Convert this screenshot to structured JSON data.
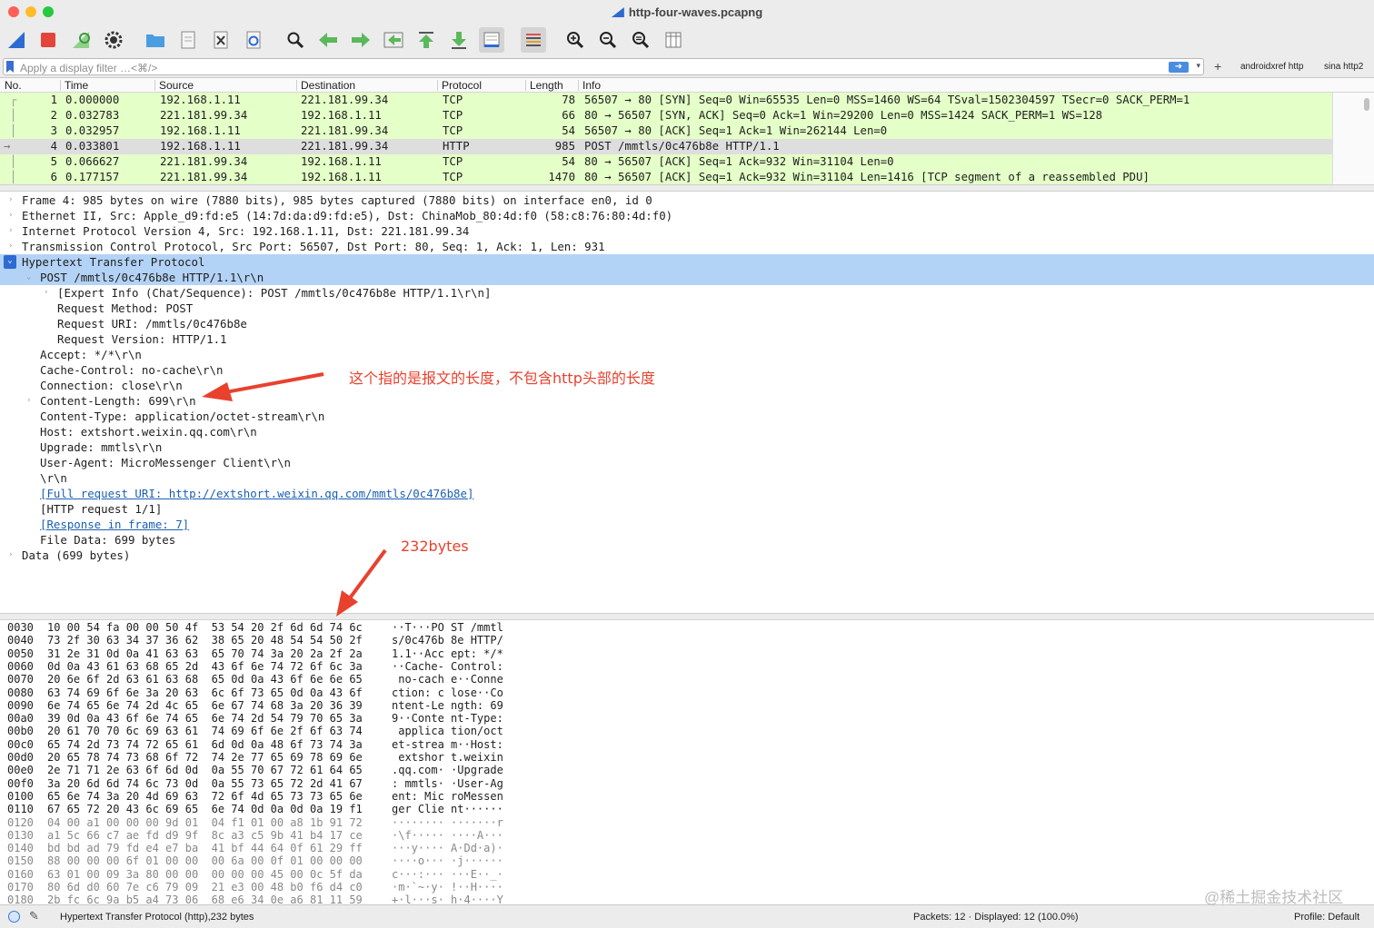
{
  "window": {
    "title": "http-four-waves.pcapng"
  },
  "colors": {
    "accent": "#3b78d6",
    "row_green": "#e4ffc7",
    "selection": "#b3d3f6",
    "annotation": "#e8412e"
  },
  "toolbar": {
    "icons": [
      "shark-fin-icon",
      "stop-icon",
      "restart-icon",
      "options-gear-icon",
      "open-folder-icon",
      "save-file-icon",
      "close-file-icon",
      "reload-icon",
      "find-icon",
      "go-back-icon",
      "go-forward-icon",
      "go-to-packet-icon",
      "go-first-icon",
      "go-last-icon",
      "autoscroll-icon",
      "colorize-icon",
      "zoom-in-icon",
      "zoom-out-icon",
      "zoom-normal-icon",
      "resize-columns-icon"
    ]
  },
  "filter": {
    "placeholder": "Apply a display filter …<⌘/>",
    "add_label": "+",
    "buttons": [
      "androidxref http",
      "sina http2"
    ]
  },
  "columns": [
    "No.",
    "Time",
    "Source",
    "Destination",
    "Protocol",
    "Length",
    "Info"
  ],
  "packets": [
    {
      "no": "1",
      "time": "0.000000",
      "src": "192.168.1.11",
      "dst": "221.181.99.34",
      "proto": "TCP",
      "len": "78",
      "info": "56507 → 80 [SYN] Seq=0 Win=65535 Len=0 MSS=1460 WS=64 TSval=1502304597 TSecr=0 SACK_PERM=1"
    },
    {
      "no": "2",
      "time": "0.032783",
      "src": "221.181.99.34",
      "dst": "192.168.1.11",
      "proto": "TCP",
      "len": "66",
      "info": "80 → 56507 [SYN, ACK] Seq=0 Ack=1 Win=29200 Len=0 MSS=1424 SACK_PERM=1 WS=128"
    },
    {
      "no": "3",
      "time": "0.032957",
      "src": "192.168.1.11",
      "dst": "221.181.99.34",
      "proto": "TCP",
      "len": "54",
      "info": "56507 → 80 [ACK] Seq=1 Ack=1 Win=262144 Len=0"
    },
    {
      "no": "4",
      "time": "0.033801",
      "src": "192.168.1.11",
      "dst": "221.181.99.34",
      "proto": "HTTP",
      "len": "985",
      "info": "POST /mmtls/0c476b8e HTTP/1.1"
    },
    {
      "no": "5",
      "time": "0.066627",
      "src": "221.181.99.34",
      "dst": "192.168.1.11",
      "proto": "TCP",
      "len": "54",
      "info": "80 → 56507 [ACK] Seq=1 Ack=932 Win=31104 Len=0"
    },
    {
      "no": "6",
      "time": "0.177157",
      "src": "221.181.99.34",
      "dst": "192.168.1.11",
      "proto": "TCP",
      "len": "1470",
      "info": "80 → 56507 [ACK] Seq=1 Ack=932 Win=31104 Len=1416 [TCP segment of a reassembled PDU]"
    }
  ],
  "details": [
    {
      "text": "Frame 4: 985 bytes on wire (7880 bits), 985 bytes captured (7880 bits) on interface en0, id 0",
      "indent": 0,
      "exp": "›"
    },
    {
      "text": "Ethernet II, Src: Apple_d9:fd:e5 (14:7d:da:d9:fd:e5), Dst: ChinaMob_80:4d:f0 (58:c8:76:80:4d:f0)",
      "indent": 0,
      "exp": "›"
    },
    {
      "text": "Internet Protocol Version 4, Src: 192.168.1.11, Dst: 221.181.99.34",
      "indent": 0,
      "exp": "›"
    },
    {
      "text": "Transmission Control Protocol, Src Port: 56507, Dst Port: 80, Seq: 1, Ack: 1, Len: 931",
      "indent": 0,
      "exp": "›"
    },
    {
      "text": "Hypertext Transfer Protocol",
      "indent": 0,
      "exp": "⌄"
    },
    {
      "text": "POST /mmtls/0c476b8e HTTP/1.1\\r\\n",
      "indent": 1,
      "exp": "⌄"
    },
    {
      "text": "[Expert Info (Chat/Sequence): POST /mmtls/0c476b8e HTTP/1.1\\r\\n]",
      "indent": 2,
      "exp": "›"
    },
    {
      "text": "Request Method: POST",
      "indent": 2,
      "exp": ""
    },
    {
      "text": "Request URI: /mmtls/0c476b8e",
      "indent": 2,
      "exp": ""
    },
    {
      "text": "Request Version: HTTP/1.1",
      "indent": 2,
      "exp": ""
    },
    {
      "text": "Accept: */*\\r\\n",
      "indent": 1,
      "exp": ""
    },
    {
      "text": "Cache-Control: no-cache\\r\\n",
      "indent": 1,
      "exp": ""
    },
    {
      "text": "Connection: close\\r\\n",
      "indent": 1,
      "exp": ""
    },
    {
      "text": "Content-Length: 699\\r\\n",
      "indent": 1,
      "exp": "›"
    },
    {
      "text": "Content-Type: application/octet-stream\\r\\n",
      "indent": 1,
      "exp": ""
    },
    {
      "text": "Host: extshort.weixin.qq.com\\r\\n",
      "indent": 1,
      "exp": ""
    },
    {
      "text": "Upgrade: mmtls\\r\\n",
      "indent": 1,
      "exp": ""
    },
    {
      "text": "User-Agent: MicroMessenger Client\\r\\n",
      "indent": 1,
      "exp": ""
    },
    {
      "text": "\\r\\n",
      "indent": 1,
      "exp": ""
    },
    {
      "text": "[Full request URI: http://extshort.weixin.qq.com/mmtls/0c476b8e]",
      "indent": 1,
      "exp": "",
      "link": true
    },
    {
      "text": "[HTTP request 1/1]",
      "indent": 1,
      "exp": ""
    },
    {
      "text": "[Response in frame: 7]",
      "indent": 1,
      "exp": "",
      "link": true
    },
    {
      "text": "File Data: 699 bytes",
      "indent": 1,
      "exp": ""
    },
    {
      "text": "Data (699 bytes)",
      "indent": 0,
      "exp": "›"
    }
  ],
  "bytes": [
    {
      "off": "0030",
      "hex": "10 00 54 fa 00 00 50 4f  53 54 20 2f 6d 6d 74 6c",
      "ascii": "··T···PO ST /mmtl"
    },
    {
      "off": "0040",
      "hex": "73 2f 30 63 34 37 36 62  38 65 20 48 54 54 50 2f",
      "ascii": "s/0c476b 8e HTTP/"
    },
    {
      "off": "0050",
      "hex": "31 2e 31 0d 0a 41 63 63  65 70 74 3a 20 2a 2f 2a",
      "ascii": "1.1··Acc ept: */*"
    },
    {
      "off": "0060",
      "hex": "0d 0a 43 61 63 68 65 2d  43 6f 6e 74 72 6f 6c 3a",
      "ascii": "··Cache- Control:"
    },
    {
      "off": "0070",
      "hex": "20 6e 6f 2d 63 61 63 68  65 0d 0a 43 6f 6e 6e 65",
      "ascii": " no-cach e··Conne"
    },
    {
      "off": "0080",
      "hex": "63 74 69 6f 6e 3a 20 63  6c 6f 73 65 0d 0a 43 6f",
      "ascii": "ction: c lose··Co"
    },
    {
      "off": "0090",
      "hex": "6e 74 65 6e 74 2d 4c 65  6e 67 74 68 3a 20 36 39",
      "ascii": "ntent-Le ngth: 69"
    },
    {
      "off": "00a0",
      "hex": "39 0d 0a 43 6f 6e 74 65  6e 74 2d 54 79 70 65 3a",
      "ascii": "9··Conte nt-Type:"
    },
    {
      "off": "00b0",
      "hex": "20 61 70 70 6c 69 63 61  74 69 6f 6e 2f 6f 63 74",
      "ascii": " applica tion/oct"
    },
    {
      "off": "00c0",
      "hex": "65 74 2d 73 74 72 65 61  6d 0d 0a 48 6f 73 74 3a",
      "ascii": "et-strea m··Host:"
    },
    {
      "off": "00d0",
      "hex": "20 65 78 74 73 68 6f 72  74 2e 77 65 69 78 69 6e",
      "ascii": " extshor t.weixin"
    },
    {
      "off": "00e0",
      "hex": "2e 71 71 2e 63 6f 6d 0d  0a 55 70 67 72 61 64 65",
      "ascii": ".qq.com· ·Upgrade"
    },
    {
      "off": "00f0",
      "hex": "3a 20 6d 6d 74 6c 73 0d  0a 55 73 65 72 2d 41 67",
      "ascii": ": mmtls· ·User-Ag"
    },
    {
      "off": "0100",
      "hex": "65 6e 74 3a 20 4d 69 63  72 6f 4d 65 73 73 65 6e",
      "ascii": "ent: Mic roMessen"
    },
    {
      "off": "0110",
      "hex": "67 65 72 20 43 6c 69 65  6e 74 0d 0a 0d 0a 19 f1",
      "ascii": "ger Clie nt······"
    },
    {
      "off": "0120",
      "hex": "04 00 a1 00 00 00 9d 01  04 f1 01 00 a8 1b 91 72",
      "ascii": "········ ·······r"
    },
    {
      "off": "0130",
      "hex": "a1 5c 66 c7 ae fd d9 9f  8c a3 c5 9b 41 b4 17 ce",
      "ascii": "·\\f····· ····A···"
    },
    {
      "off": "0140",
      "hex": "bd bd ad 79 fd e4 e7 ba  41 bf 44 64 0f 61 29 ff",
      "ascii": "···y···· A·Dd·a)·"
    },
    {
      "off": "0150",
      "hex": "88 00 00 00 6f 01 00 00  00 6a 00 0f 01 00 00 00",
      "ascii": "····o··· ·j······"
    },
    {
      "off": "0160",
      "hex": "63 01 00 09 3a 80 00 00  00 00 00 45 00 0c 5f da",
      "ascii": "c···:··· ···E··_·"
    },
    {
      "off": "0170",
      "hex": "80 6d d0 60 7e c6 79 09  21 e3 00 48 b0 f6 d4 c0",
      "ascii": "·m·`~·y· !··H····"
    },
    {
      "off": "0180",
      "hex": "2b fc 6c 9a b5 a4 73 06  68 e6 34 0e a6 81 11 59",
      "ascii": "+·l···s· h·4····Y"
    }
  ],
  "status": {
    "text": "Hypertext Transfer Protocol (http),232 bytes",
    "packets": "Packets: 12 · Displayed: 12 (100.0%)",
    "profile": "Profile: Default"
  },
  "annotations": {
    "content_length_note": "这个指的是报文的长度，不包含http头部的长度",
    "bytes_note": "232bytes"
  },
  "watermark": "@稀土掘金技术社区"
}
